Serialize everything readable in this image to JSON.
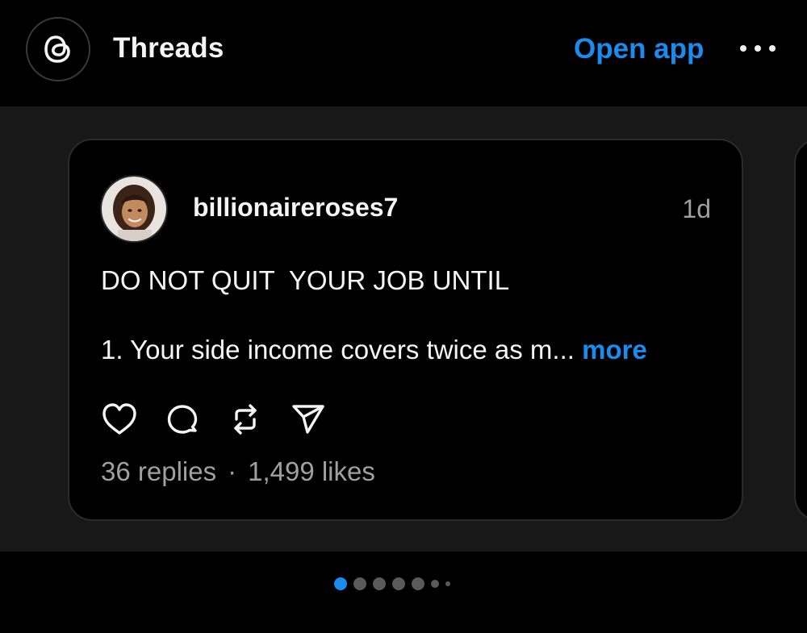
{
  "header": {
    "app_title": "Threads",
    "open_app_label": "Open app",
    "logo_icon": "threads-logo-icon",
    "more_icon": "more-horizontal-icon"
  },
  "post": {
    "username": "billionaireroses7",
    "timestamp": "1d",
    "text_line_1": "DO NOT QUIT  YOUR JOB UNTIL",
    "text_line_2": "1. Your side income covers twice as m... ",
    "more_label": "more",
    "actions": [
      "heart-icon",
      "comment-icon",
      "repost-icon",
      "share-icon"
    ],
    "replies": "36 replies",
    "separator": "·",
    "likes": "1,499 likes"
  },
  "pager": {
    "total_dots": 7,
    "active_index": 0
  },
  "colors": {
    "accent": "#1a8cf0",
    "background": "#000000",
    "carousel_background": "#181818",
    "muted_text": "#a0a0a0"
  }
}
